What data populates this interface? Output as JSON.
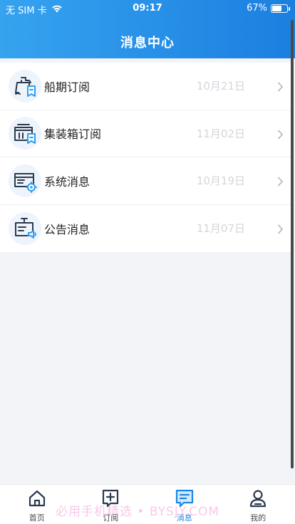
{
  "status_bar": {
    "carrier": "无 SIM 卡",
    "time": "09:17",
    "battery_percent": "67%",
    "battery_level": 0.67
  },
  "header": {
    "title": "消息中心"
  },
  "messages": [
    {
      "label": "船期订阅",
      "date": "10月21日",
      "icon": "ship-subscription-icon"
    },
    {
      "label": "集装箱订阅",
      "date": "11月02日",
      "icon": "container-subscription-icon"
    },
    {
      "label": "系统消息",
      "date": "10月19日",
      "icon": "system-settings-icon"
    },
    {
      "label": "公告消息",
      "date": "11月07日",
      "icon": "announcement-icon"
    }
  ],
  "tabbar": {
    "tabs": [
      {
        "label": "首页",
        "icon": "home-icon"
      },
      {
        "label": "订阅",
        "icon": "add-subscription-icon"
      },
      {
        "label": "消息",
        "icon": "message-icon",
        "active": true
      },
      {
        "label": "我的",
        "icon": "profile-icon"
      }
    ]
  },
  "watermark": "必用手机精选 • BYSJY.COM",
  "colors": {
    "header_start": "#36a3ef",
    "header_end": "#1b7fe0",
    "accent": "#1b87e6",
    "icon_dark": "#2d3a4f",
    "date": "#d4d6db"
  }
}
